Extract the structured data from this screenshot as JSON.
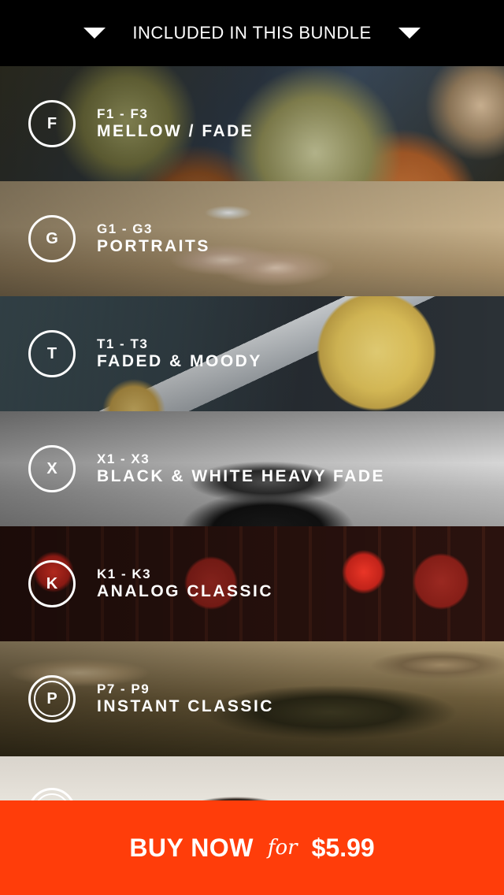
{
  "header": {
    "title": "INCLUDED IN THIS BUNDLE"
  },
  "filters": [
    {
      "badge": "F",
      "range": "F1 - F3",
      "name": "MELLOW / FADE"
    },
    {
      "badge": "G",
      "range": "G1 - G3",
      "name": "PORTRAITS"
    },
    {
      "badge": "T",
      "range": "T1 - T3",
      "name": "FADED & MOODY"
    },
    {
      "badge": "X",
      "range": "X1 - X3",
      "name": "BLACK & WHITE HEAVY FADE"
    },
    {
      "badge": "K",
      "range": "K1 - K3",
      "name": "ANALOG CLASSIC"
    },
    {
      "badge": "P",
      "range": "P7 - P9",
      "name": "INSTANT CLASSIC"
    }
  ],
  "buy": {
    "label": "BUY NOW",
    "connector": "for",
    "price": "$5.99"
  },
  "colors": {
    "header_bg": "#000000",
    "buy_bg": "#ff3d0a",
    "text": "#ffffff"
  }
}
